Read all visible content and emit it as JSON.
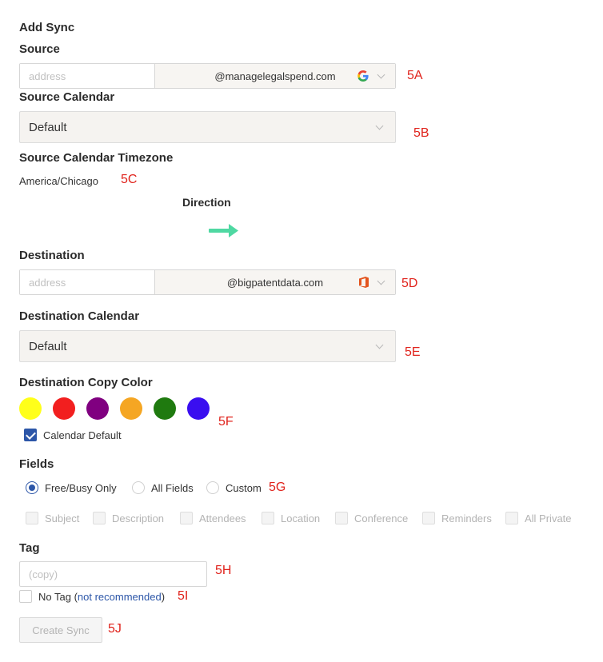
{
  "title": "Add Sync",
  "source": {
    "label": "Source",
    "address_placeholder": "address",
    "domain": "@managelegalspend.com",
    "provider_icon": "google-icon",
    "annotation": "5A"
  },
  "source_calendar": {
    "label": "Source Calendar",
    "value": "Default",
    "annotation": "5B"
  },
  "source_timezone": {
    "label": "Source Calendar Timezone",
    "value": "America/Chicago",
    "annotation": "5C"
  },
  "direction": {
    "label": "Direction",
    "icon": "arrow-right-icon",
    "color": "#4fd8a2"
  },
  "destination": {
    "label": "Destination",
    "address_placeholder": "address",
    "domain": "@bigpatentdata.com",
    "provider_icon": "office-icon",
    "annotation": "5D"
  },
  "destination_calendar": {
    "label": "Destination Calendar",
    "value": "Default",
    "annotation": "5E"
  },
  "copy_color": {
    "label": "Destination Copy Color",
    "colors": [
      "#ffff1a",
      "#f21f1f",
      "#800080",
      "#f5a623",
      "#1f7a0f",
      "#3a0ef0"
    ],
    "calendar_default_label": "Calendar Default",
    "calendar_default_checked": true,
    "annotation": "5F"
  },
  "fields": {
    "label": "Fields",
    "options": [
      "Free/Busy Only",
      "All Fields",
      "Custom"
    ],
    "selected": "Free/Busy Only",
    "annotation": "5G",
    "custom_fields": [
      "Subject",
      "Description",
      "Attendees",
      "Location",
      "Conference",
      "Reminders",
      "All Private"
    ]
  },
  "tag": {
    "label": "Tag",
    "placeholder": "(copy)",
    "annotation": "5H",
    "no_tag_label": "No Tag (",
    "no_tag_link": "not recommended",
    "no_tag_close": ")",
    "no_tag_annotation": "5I"
  },
  "create": {
    "label": "Create Sync",
    "annotation": "5J"
  }
}
